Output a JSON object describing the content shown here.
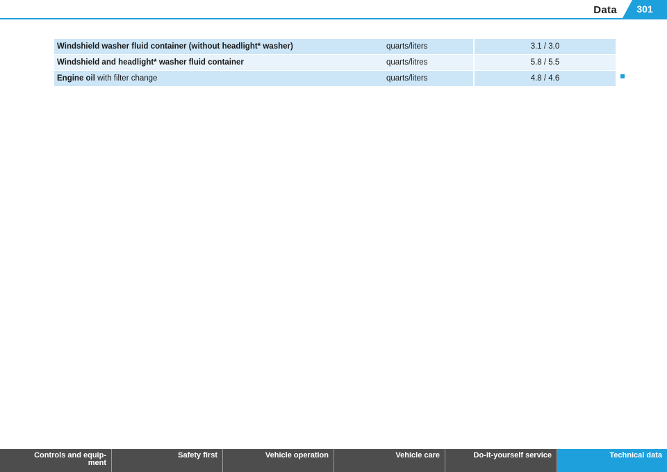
{
  "header": {
    "section_title": "Data",
    "page_number": "301"
  },
  "table": {
    "rows": [
      {
        "label_bold": "Windshield washer fluid container (without headlight* washer)",
        "label_rest": "",
        "unit": "quarts/liters",
        "value": "3.1 / 3.0"
      },
      {
        "label_bold": "Windshield and headlight* washer fluid container",
        "label_rest": "",
        "unit": "quarts/litres",
        "value": "5.8 / 5.5"
      },
      {
        "label_bold": "Engine oil",
        "label_rest": " with filter change",
        "unit": "quarts/liters",
        "value": "4.8 / 4.6"
      }
    ]
  },
  "footer": {
    "tabs": [
      {
        "label": "Controls and equip-\nment"
      },
      {
        "label": "Safety first"
      },
      {
        "label": "Vehicle operation"
      },
      {
        "label": "Vehicle care"
      },
      {
        "label": "Do-it-yourself service"
      },
      {
        "label": "Technical data"
      }
    ]
  },
  "colors": {
    "accent": "#1ea0dc",
    "row_shade": "#cde6f7",
    "row_light": "#e8f3fb",
    "footer_bg": "#4d4d4d"
  }
}
